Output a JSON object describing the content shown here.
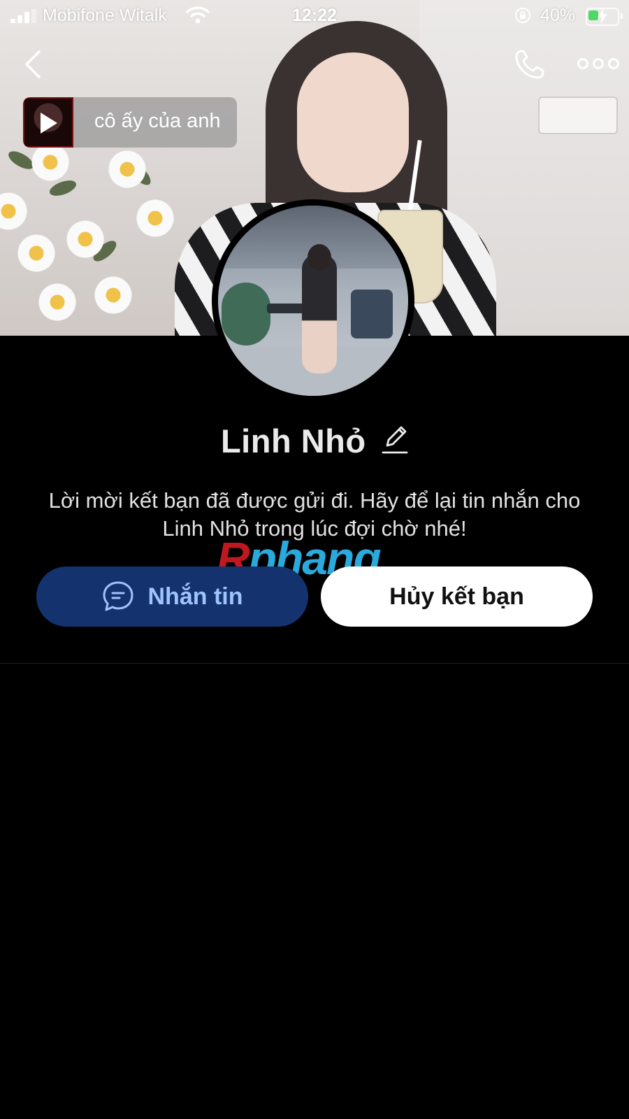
{
  "status_bar": {
    "carrier": "Mobifone Witalk",
    "time": "12:22",
    "battery_percent": "40%",
    "battery_level": 0.4,
    "charging": true
  },
  "header": {
    "back_icon": "chevron-left-icon",
    "call_icon": "phone-icon",
    "more_icon": "more-dots-icon"
  },
  "music": {
    "title": "cô ấy của anh",
    "icon": "play-icon"
  },
  "profile": {
    "name": "Linh Nhỏ",
    "edit_icon": "pencil-icon",
    "message": "Lời mời kết bạn đã được gửi đi. Hãy để lại tin nhắn cho Linh Nhỏ trong lúc đợi chờ nhé!"
  },
  "watermark": {
    "first": "R",
    "rest": "phang"
  },
  "actions": {
    "message_label": "Nhắn tin",
    "message_icon": "chat-bubble-icon",
    "unfriend_label": "Hủy kết bạn"
  },
  "colors": {
    "primary_button_bg": "#14326e",
    "primary_button_text": "#9fc3ff",
    "secondary_button_bg": "#ffffff",
    "background": "#000000"
  }
}
